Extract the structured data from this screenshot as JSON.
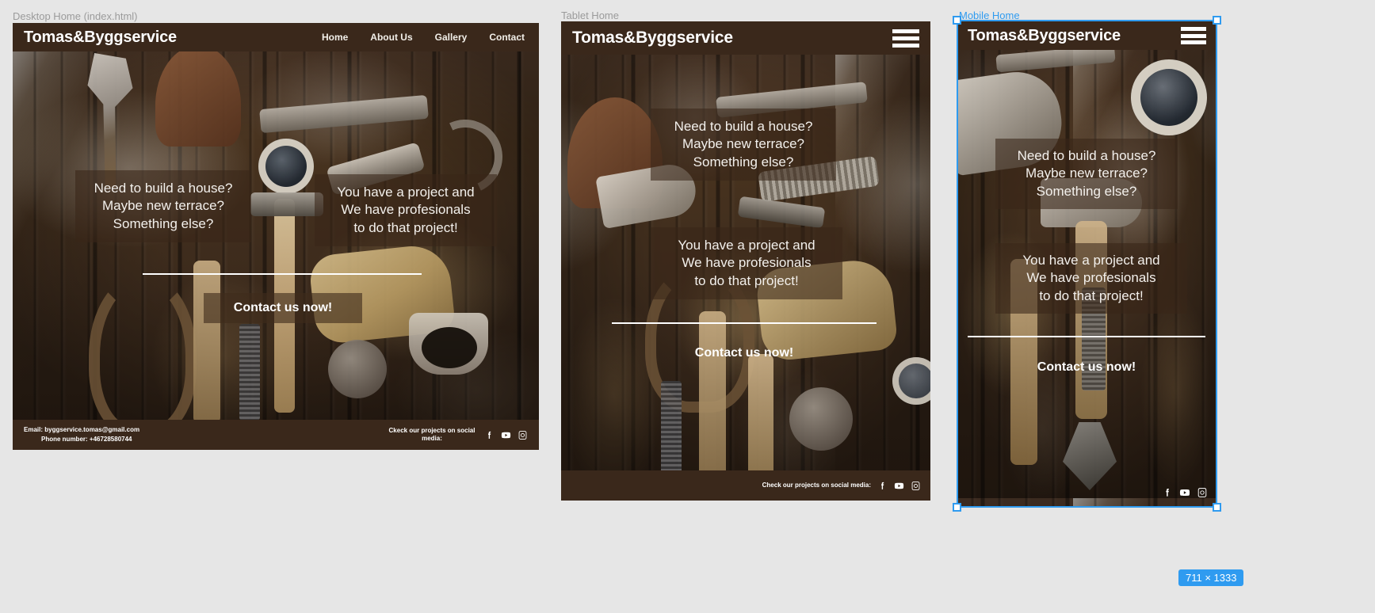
{
  "workspace": {
    "background_color": "#e6e6e6",
    "selection_color": "#2f9bf0",
    "panels": [
      {
        "label": "Desktop Home (index.html)",
        "selected": false
      },
      {
        "label": "Tablet Home",
        "selected": false
      },
      {
        "label": "Mobile Home",
        "selected": true
      }
    ],
    "size_badge": "711 × 1333"
  },
  "site": {
    "brand": "Tomas&Byggservice",
    "brand_color": "#ffffff",
    "header_color": "#3a281b",
    "nav": [
      {
        "label": "Home"
      },
      {
        "label": "About Us"
      },
      {
        "label": "Gallery"
      },
      {
        "label": "Contact"
      }
    ],
    "menu_icon": "hamburger-icon",
    "hero": {
      "left_block": {
        "line1": "Need to build a house?",
        "line2": "Maybe new terrace?",
        "line3": "Something else?"
      },
      "right_block": {
        "line1": "You have a project and",
        "line2": "We have profesionals",
        "line3": "to do that project!"
      },
      "cta_label": "Contact us now!"
    },
    "footer": {
      "email_label": "Email: byggservice.tomas@gmail.com",
      "phone_label": "Phone number: +46728580744",
      "social_caption_desktop": "Ckeck our projects on social media:",
      "social_caption_tablet": "Check our projects on social media:",
      "social_icons": [
        {
          "name": "facebook-icon"
        },
        {
          "name": "youtube-icon"
        },
        {
          "name": "instagram-icon"
        }
      ]
    }
  }
}
